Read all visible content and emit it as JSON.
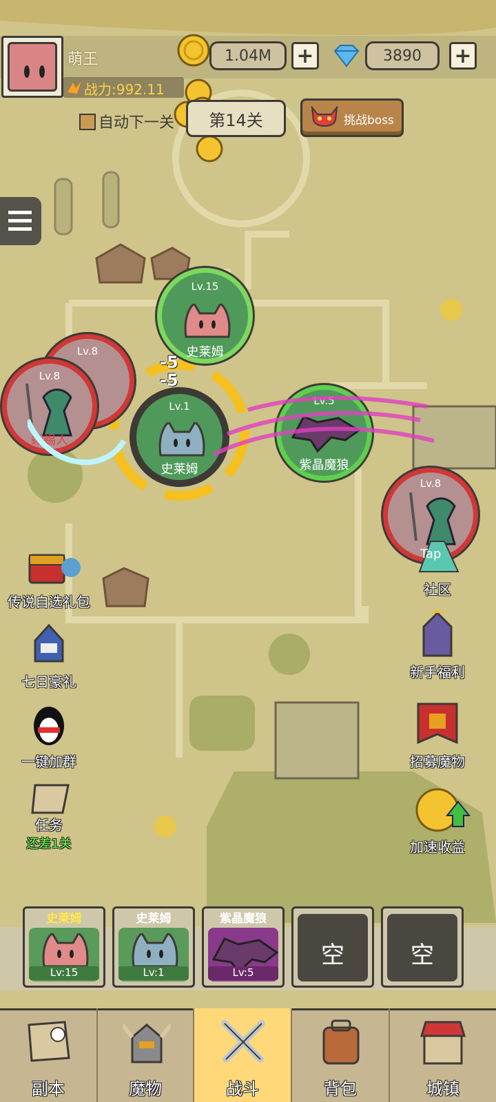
{
  "player": {
    "name": "萌王",
    "power": "战力:992.11"
  },
  "currency": {
    "gold": "1.04M",
    "diamonds": "3890"
  },
  "stage": {
    "label": "第14关",
    "auto_next": "自动下一关",
    "boss_button": "挑战boss"
  },
  "units": {
    "ally_top": {
      "level": "Lv.15",
      "name": "史莱姆"
    },
    "ally_front": {
      "level": "Lv.1",
      "name": "史莱姆"
    },
    "ally_wolf": {
      "level": "Lv.5",
      "name": "紫晶魔狼"
    },
    "enemy_1": {
      "level": "Lv.8",
      "name": "蜥蜴人"
    },
    "enemy_2": {
      "level": "Lv.8"
    },
    "enemy_3": {
      "level": "Lv.8"
    }
  },
  "damage_numbers": [
    "-5",
    "-5"
  ],
  "left_menu": [
    {
      "label": "传说自选礼包"
    },
    {
      "label": "七日豪礼"
    },
    {
      "label": "一键加群"
    },
    {
      "label": "任务",
      "sub": "还差1关"
    }
  ],
  "right_menu": [
    {
      "label": "社区",
      "badge": "Tap"
    },
    {
      "label": "新手福利"
    },
    {
      "label": "招募魔物"
    },
    {
      "label": "加速收益"
    }
  ],
  "team_slots": [
    {
      "name": "史莱姆",
      "level": "Lv:15",
      "color": "#4a9a4a"
    },
    {
      "name": "史莱姆",
      "level": "Lv:1",
      "color": "#4a9a4a"
    },
    {
      "name": "紫晶魔狼",
      "level": "Lv:5",
      "color": "#8a3a8a"
    },
    {
      "empty": "空"
    },
    {
      "empty": "空"
    }
  ],
  "nav": [
    {
      "label": "副本"
    },
    {
      "label": "魔物"
    },
    {
      "label": "战斗",
      "active": true
    },
    {
      "label": "背包"
    },
    {
      "label": "城镇"
    }
  ]
}
